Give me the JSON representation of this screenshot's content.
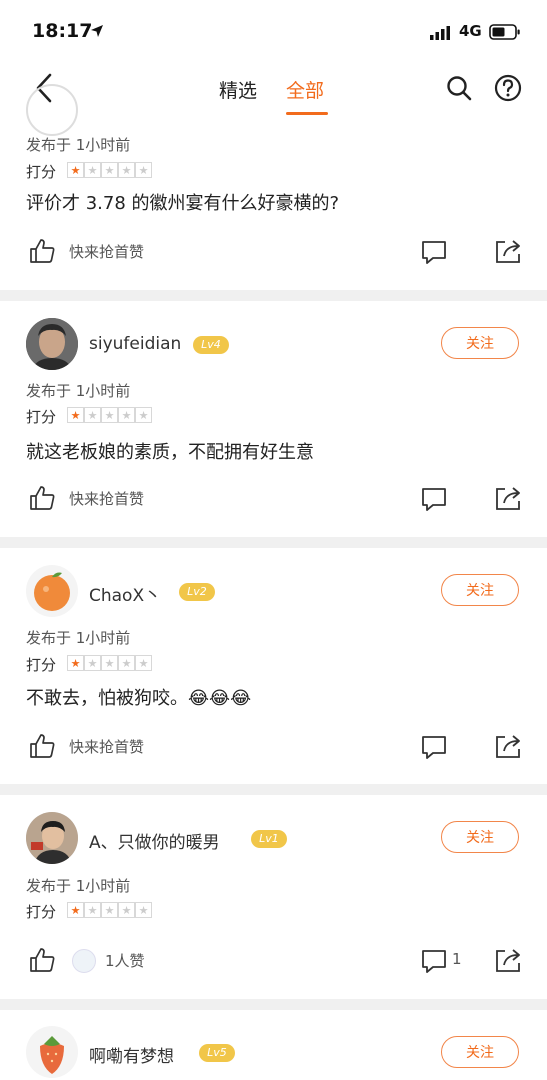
{
  "status_bar": {
    "time": "18:17",
    "network": "4G"
  },
  "nav": {
    "tabs": [
      {
        "label": "精选"
      },
      {
        "label": "全部"
      }
    ]
  },
  "common": {
    "posted": "发布于 1小时前",
    "score_label": "打分",
    "like_prompt": "快来抢首赞",
    "follow": "关注"
  },
  "reviews": [
    {
      "content": "评价才 3.78 的徽州宴有什么好豪横的?",
      "rating": 1
    },
    {
      "user": "siyufeidian",
      "level": "Lv4",
      "content": "就这老板娘的素质，不配拥有好生意",
      "rating": 1
    },
    {
      "user": "ChaoX丶",
      "level": "Lv2",
      "content": "不敢去，怕被狗咬。😂😂😂",
      "rating": 1
    },
    {
      "user": "A、只做你的暖男",
      "level": "Lv1",
      "likes": "1人赞",
      "comments": "1",
      "rating": 1
    },
    {
      "user": "啊嘞有梦想",
      "level": "Lv5"
    }
  ]
}
